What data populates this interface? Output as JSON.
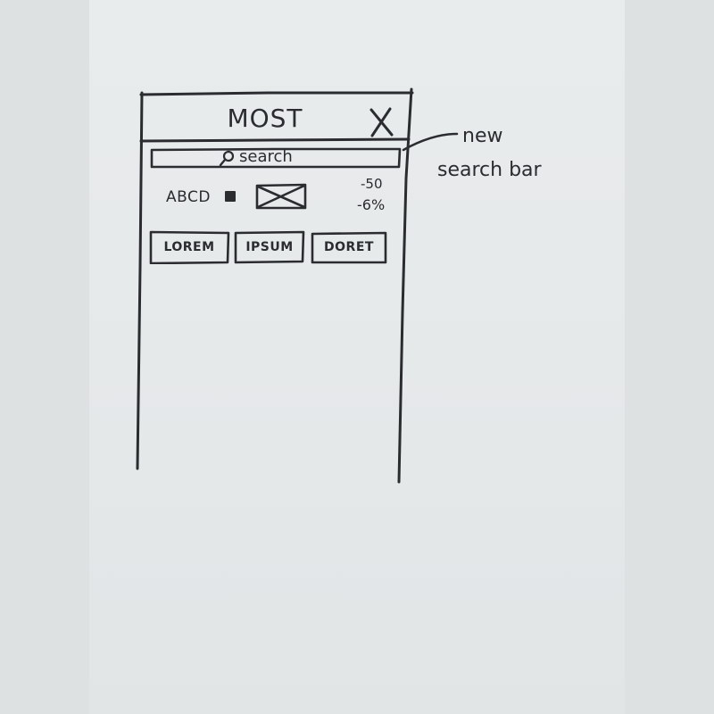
{
  "header": {
    "title": "MOST",
    "close_glyph": "X"
  },
  "search": {
    "placeholder": "search"
  },
  "item": {
    "label": "ABCD",
    "price_line1": "-50",
    "price_line2": "-6%"
  },
  "buttons": [
    {
      "label": "LOREM"
    },
    {
      "label": "IPSUM"
    },
    {
      "label": "DORET"
    }
  ],
  "annotation": {
    "line1": "new",
    "line2": "search bar"
  },
  "icons": {
    "search": "search-icon",
    "close": "close-icon",
    "image_placeholder": "image-placeholder-icon",
    "checkbox": "checkbox-icon"
  },
  "colors": {
    "ink": "#2a2c30",
    "paper": "#e6e9ea",
    "background": "#dde1e2"
  }
}
